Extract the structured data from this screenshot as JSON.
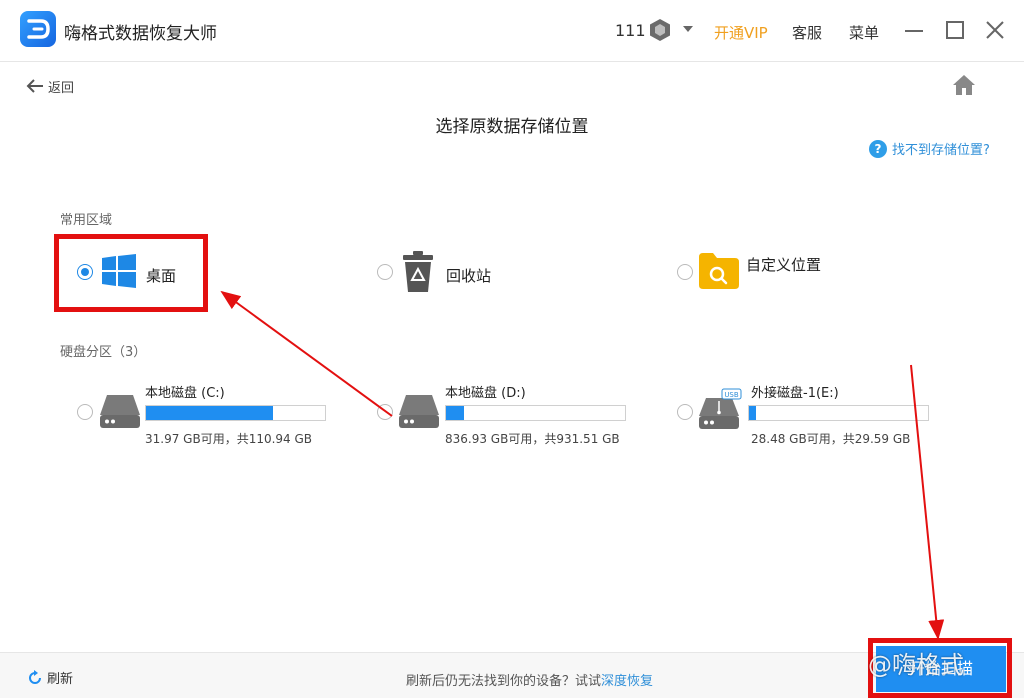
{
  "header": {
    "app_title": "嗨格式数据恢复大师",
    "user_id": "111",
    "vip_label": "开通VIP",
    "service_label": "客服",
    "menu_label": "菜单"
  },
  "nav": {
    "back_label": "返回",
    "page_title": "选择原数据存储位置",
    "help_label": "找不到存储位置?"
  },
  "common_area": {
    "label": "常用区域",
    "locations": [
      {
        "label": "桌面",
        "selected": true,
        "icon": "windows-icon"
      },
      {
        "label": "回收站",
        "selected": false,
        "icon": "recycle-bin-icon"
      },
      {
        "label": "自定义位置",
        "selected": false,
        "icon": "folder-search-icon"
      }
    ]
  },
  "disk_area": {
    "label": "硬盘分区（3）",
    "drives": [
      {
        "name": "本地磁盘 (C:)",
        "size_text": "31.97 GB可用，共110.94 GB",
        "used_fraction": 0.71,
        "icon": "hard-drive-icon"
      },
      {
        "name": "本地磁盘 (D:)",
        "size_text": "836.93 GB可用，共931.51 GB",
        "used_fraction": 0.1,
        "icon": "hard-drive-icon"
      },
      {
        "name": "外接磁盘-1(E:)",
        "size_text": "28.48 GB可用，共29.59 GB",
        "used_fraction": 0.04,
        "icon": "usb-drive-icon"
      }
    ]
  },
  "footer": {
    "refresh_label": "刷新",
    "tip_text": "刷新后仍无法找到你的设备？试试",
    "tip_link": "深度恢复",
    "start_button": "开始扫描",
    "watermark": "@嗨格式"
  },
  "colors": {
    "accent": "#1f8ef1",
    "vip": "#f0a020",
    "annotation_red": "#e31010",
    "link": "#2f8fd8"
  }
}
